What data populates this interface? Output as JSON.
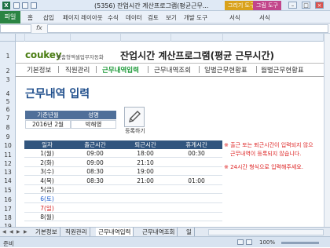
{
  "window": {
    "title": "(5356) 잔업시간 계산프로그램(평균근무...",
    "app_icon": "X",
    "context_tab_1": "그리기 도구",
    "context_tab_2": "그림 도구",
    "minimize": "–",
    "maximize": "□",
    "close": "×",
    "context_color_1": "#d9a21b",
    "context_color_2": "#c2458b"
  },
  "ribbon": {
    "file": "파일",
    "tabs": [
      "홈",
      "삽입",
      "페이지 레이아웃",
      "수식",
      "데이터",
      "검토",
      "보기",
      "개발 도구",
      "서식",
      "서식"
    ]
  },
  "formula_bar": {
    "fx": "fx"
  },
  "rows": [
    "1",
    "2",
    "3",
    "4",
    "5",
    "6",
    "7",
    "8",
    "9",
    "10",
    "11",
    "12",
    "13",
    "14",
    "15",
    "16",
    "17",
    "18",
    "19"
  ],
  "sheet": {
    "logo": "coukey",
    "logo_sub": "맞춤형엑셀업무자동화",
    "app_title": "잔업시간 계산프로그램(평균 근무시간)",
    "nav": [
      "기본정보",
      "직원관리",
      "근무내역입력",
      "근무내역조회",
      "일별근무현황표",
      "월별근무현황표"
    ],
    "active_nav": "근무내역입력",
    "heading": "근무내역 입력",
    "period_label": "기준년월",
    "period_value": "2016년 2월",
    "name_label": "성명",
    "name_value": "박해영",
    "register_label": "등록하기",
    "table_headers": [
      "일자",
      "출근시간",
      "퇴근시간",
      "휴게시간"
    ],
    "table_rows": [
      {
        "day": "1(월)",
        "in": "09:00",
        "out": "18:00",
        "rest": "00:30",
        "color": "#222222"
      },
      {
        "day": "2(화)",
        "in": "09:00",
        "out": "21:10",
        "rest": "",
        "color": "#222222"
      },
      {
        "day": "3(수)",
        "in": "08:30",
        "out": "19:00",
        "rest": "",
        "color": "#222222"
      },
      {
        "day": "4(목)",
        "in": "08:30",
        "out": "21:00",
        "rest": "01:00",
        "color": "#222222"
      },
      {
        "day": "5(금)",
        "in": "",
        "out": "",
        "rest": "",
        "color": "#222222"
      },
      {
        "day": "6(토)",
        "in": "",
        "out": "",
        "rest": "",
        "color": "#1f5fcf"
      },
      {
        "day": "7(일)",
        "in": "",
        "out": "",
        "rest": "",
        "color": "#d42020"
      },
      {
        "day": "8(월)",
        "in": "",
        "out": "",
        "rest": "",
        "color": "#222222"
      }
    ],
    "note_1a": "※ 출근 또는 퇴근시간이 입력되지 않으",
    "note_1b": "근무내역이 등록되지 않습니다.",
    "note_2": "※ 24시간 형식으로 입력해주세요."
  },
  "tabs": {
    "sheets": [
      "기본정보",
      "직원관리",
      "근무내역입력",
      "근무내역조회",
      "일"
    ],
    "active": "근무내역입력"
  },
  "status": {
    "ready": "준비",
    "zoom": "100%"
  }
}
